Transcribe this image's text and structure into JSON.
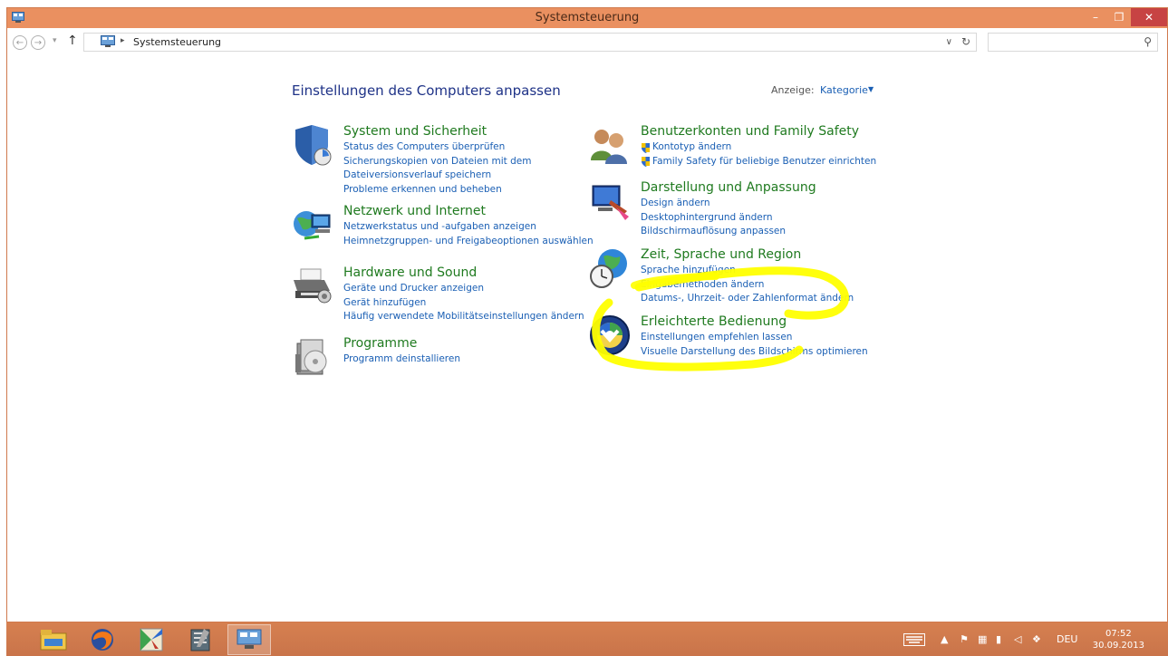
{
  "window": {
    "title": "Systemsteuerung"
  },
  "address": {
    "path": "Systemsteuerung",
    "search_placeholder": ""
  },
  "header": {
    "title": "Einstellungen des Computers anpassen",
    "view_label": "Anzeige:",
    "view_value": "Kategorie"
  },
  "categories": [
    {
      "title": "System und Sicherheit",
      "links": [
        "Status des Computers überprüfen",
        "Sicherungskopien von Dateien mit dem",
        "Dateiversionsverlauf speichern",
        "Probleme erkennen und beheben"
      ]
    },
    {
      "title": "Netzwerk und Internet",
      "links": [
        "Netzwerkstatus und -aufgaben anzeigen",
        "Heimnetzgruppen- und Freigabeoptionen auswählen"
      ]
    },
    {
      "title": "Hardware und Sound",
      "links": [
        "Geräte und Drucker anzeigen",
        "Gerät hinzufügen",
        "Häufig verwendete Mobilitätseinstellungen ändern"
      ]
    },
    {
      "title": "Programme",
      "links": [
        "Programm deinstallieren"
      ]
    },
    {
      "title": "Benutzerkonten und Family Safety",
      "links": [
        "Kontotyp ändern",
        "Family Safety für beliebige Benutzer einrichten"
      ]
    },
    {
      "title": "Darstellung und Anpassung",
      "links": [
        "Design ändern",
        "Desktophintergrund ändern",
        "Bildschirmauflösung anpassen"
      ]
    },
    {
      "title": "Zeit, Sprache und Region",
      "links": [
        "Sprache hinzufügen",
        "Eingabemethoden ändern",
        "Datums-, Uhrzeit- oder Zahlenformat ändern"
      ]
    },
    {
      "title": "Erleichterte Bedienung",
      "links": [
        "Einstellungen empfehlen lassen",
        "Visuelle Darstellung des Bildschirms optimieren"
      ]
    }
  ],
  "taskbar": {
    "apps": [
      "file-explorer-icon",
      "firefox-icon",
      "paint-icon",
      "notepad-icon",
      "control-panel-icon"
    ],
    "language": "DEU",
    "time": "07:52",
    "date": "30.09.2013"
  },
  "colors": {
    "titlebar": "#ea9060",
    "taskbar": "#d68050",
    "category_title": "#1f7a1f",
    "link": "#1a5fb4",
    "highlight": "#ffff00"
  }
}
